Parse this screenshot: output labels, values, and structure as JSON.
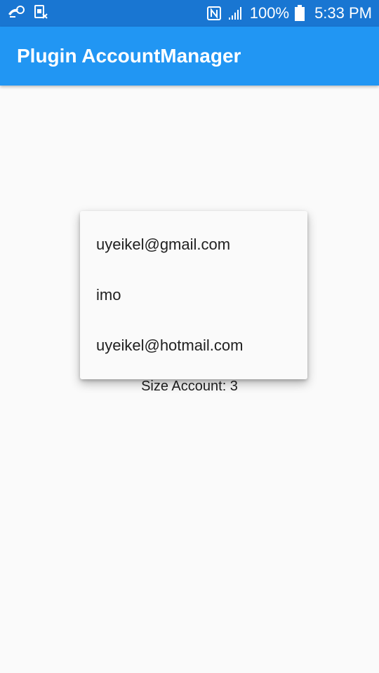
{
  "status_bar": {
    "left_icons": [
      "notification-app-icon",
      "sim-card-icon"
    ],
    "nfc_icon": "nfc-icon",
    "signal_icon": "signal-icon",
    "battery_percent": "100%",
    "battery_icon": "battery-icon",
    "time": "5:33 PM"
  },
  "app_bar": {
    "title": "Plugin AccountManager",
    "color": "#2196f3"
  },
  "main": {
    "size_label": "Size Account: 3"
  },
  "popup_menu": {
    "items": [
      {
        "label": "uyeikel@gmail.com"
      },
      {
        "label": "imo"
      },
      {
        "label": "uyeikel@hotmail.com"
      }
    ]
  },
  "colors": {
    "status_bar": "#1976d2",
    "app_bar": "#2196f3",
    "background": "#fafafa",
    "text": "#212121"
  }
}
